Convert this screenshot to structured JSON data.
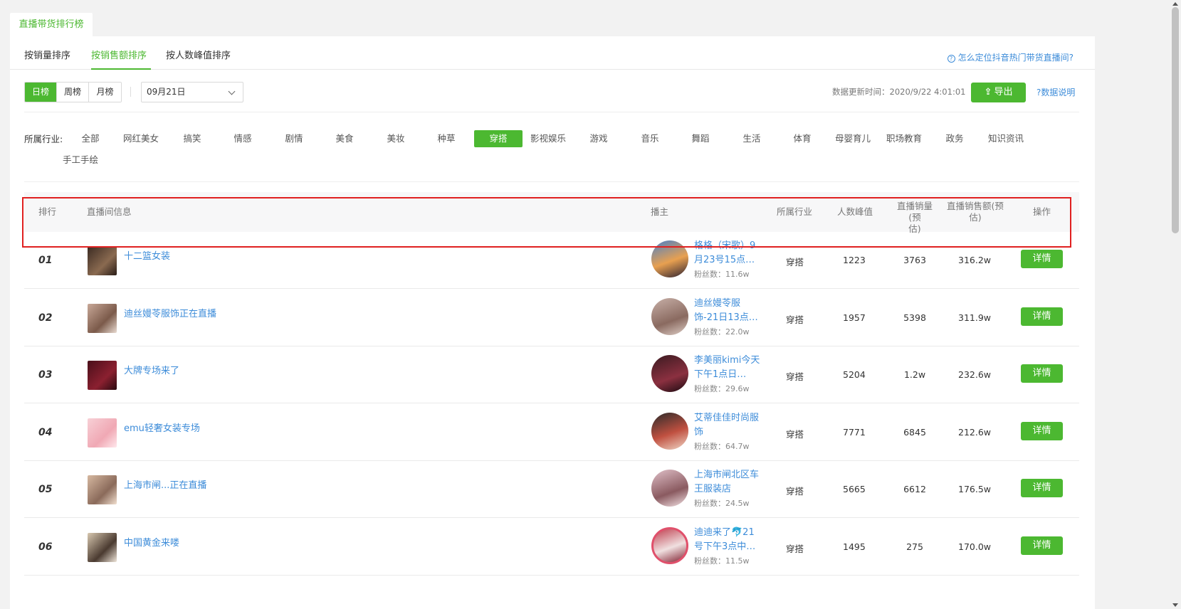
{
  "top_tab": "直播带货排行榜",
  "sort_tabs": [
    "按销量排序",
    "按销售额排序",
    "按人数峰值排序"
  ],
  "help_link": "怎么定位抖音热门带货直播间?",
  "period": {
    "day": "日榜",
    "week": "周榜",
    "month": "月榜"
  },
  "date_value": "09月21日",
  "update_time": "数据更新时间：2020/9/22 4:01:01",
  "export_label": "导出",
  "data_note": "?数据说明",
  "industry_label": "所属行业:",
  "industries": [
    "全部",
    "网红美女",
    "搞笑",
    "情感",
    "剧情",
    "美食",
    "美妆",
    "种草",
    "穿搭",
    "影视娱乐",
    "游戏",
    "音乐",
    "舞蹈",
    "生活",
    "体育",
    "母婴育儿",
    "职场教育",
    "政务",
    "知识资讯",
    "手工手绘"
  ],
  "headers": {
    "rank": "排行",
    "room": "直播间信息",
    "host": "播主",
    "industry": "所属行业",
    "peak": "人数峰值",
    "sales_l1": "直播销量(预",
    "sales_l2": "估)",
    "amount_l1": "直播销售额(预",
    "amount_l2": "估)",
    "action": "操作"
  },
  "rows": [
    {
      "rank": "01",
      "room": "十二篮女装",
      "host": "格格（宋歌）9月23号15点…",
      "fans": "粉丝数：11.6w",
      "industry": "穿搭",
      "peak": "1223",
      "sales": "3763",
      "amount": "316.2w",
      "action": "详情"
    },
    {
      "rank": "02",
      "room": "迪丝嫚苓服饰正在直播",
      "host": "迪丝嫚苓服饰-21日13点…",
      "fans": "粉丝数：22.0w",
      "industry": "穿搭",
      "peak": "1957",
      "sales": "5398",
      "amount": "311.9w",
      "action": "详情"
    },
    {
      "rank": "03",
      "room": "大牌专场来了",
      "host": "李美丽kimi今天下午1点日…",
      "fans": "粉丝数：29.6w",
      "industry": "穿搭",
      "peak": "5204",
      "sales": "1.2w",
      "amount": "232.6w",
      "action": "详情"
    },
    {
      "rank": "04",
      "room": "emu轻奢女装专场",
      "host": "艾蒂佳佳时尚服饰",
      "fans": "粉丝数：64.7w",
      "industry": "穿搭",
      "peak": "7771",
      "sales": "6845",
      "amount": "212.6w",
      "action": "详情"
    },
    {
      "rank": "05",
      "room": "上海市闸...正在直播",
      "host": "上海市闸北区车王服装店",
      "fans": "粉丝数：24.5w",
      "industry": "穿搭",
      "peak": "5665",
      "sales": "6612",
      "amount": "176.5w",
      "action": "详情"
    },
    {
      "rank": "06",
      "room": "中国黄金来喽",
      "host": "迪迪来了🐬21号下午3点中…",
      "fans": "粉丝数：11.5w",
      "industry": "穿搭",
      "peak": "1495",
      "sales": "275",
      "amount": "170.0w",
      "action": "详情"
    }
  ],
  "colors": {
    "accent": "#4cb831",
    "link": "#3d8cd9",
    "highlight": "#e02020"
  }
}
